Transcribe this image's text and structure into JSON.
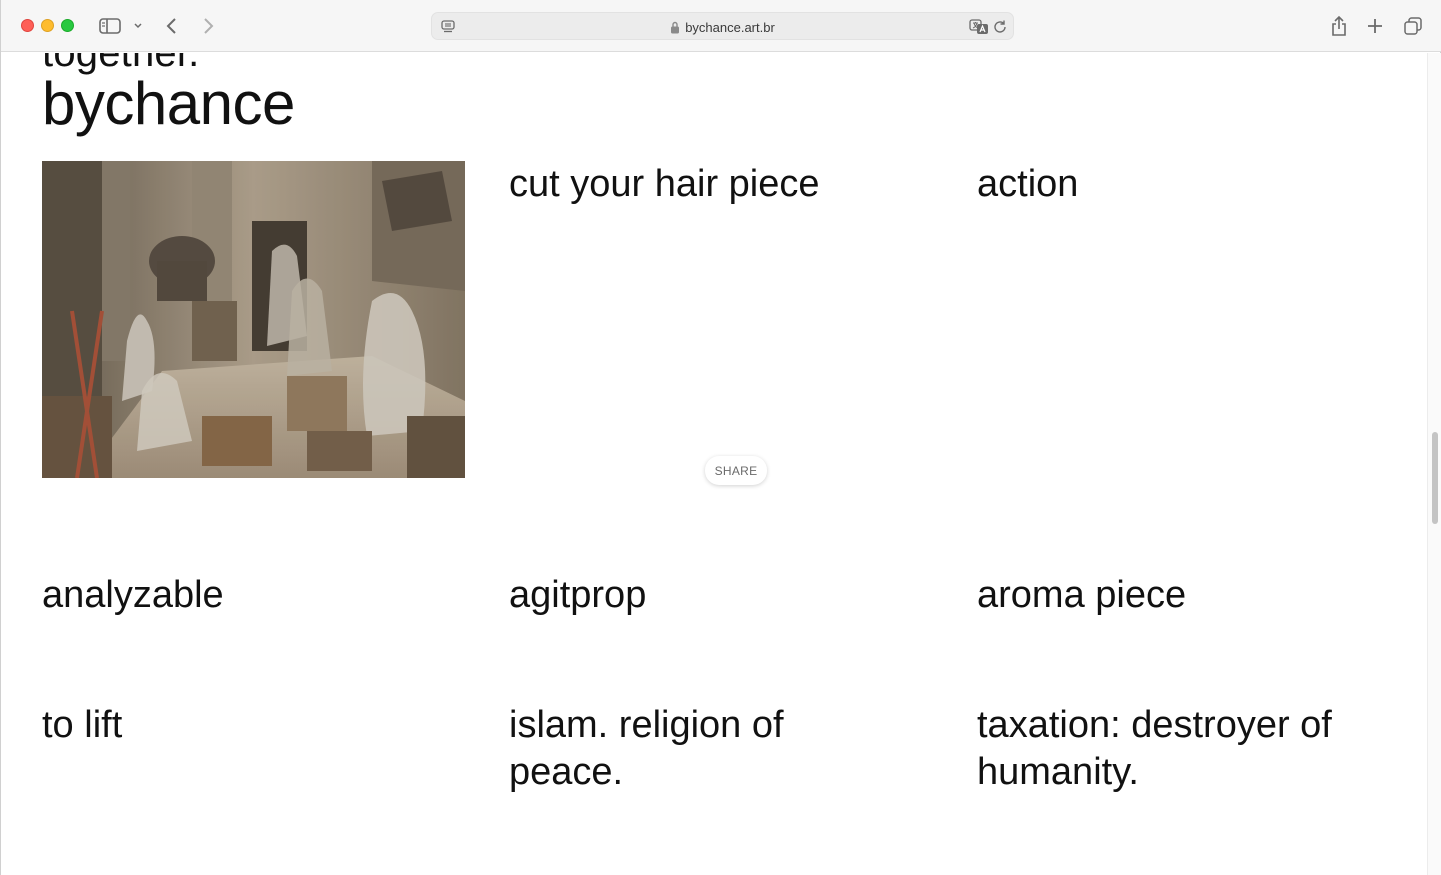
{
  "browser": {
    "url": "bychance.art.br"
  },
  "page": {
    "partial_heading": "together.",
    "site_title": "bychance",
    "share_label": "SHARE",
    "items": [
      {
        "title": "cut your hair piece"
      },
      {
        "title": "action"
      },
      {
        "title": "analyzable"
      },
      {
        "title": "agitprop"
      },
      {
        "title": "aroma piece"
      },
      {
        "title": "to lift"
      },
      {
        "title": "islam. religion of peace."
      },
      {
        "title": "taxation: destroyer of humanity."
      }
    ]
  }
}
